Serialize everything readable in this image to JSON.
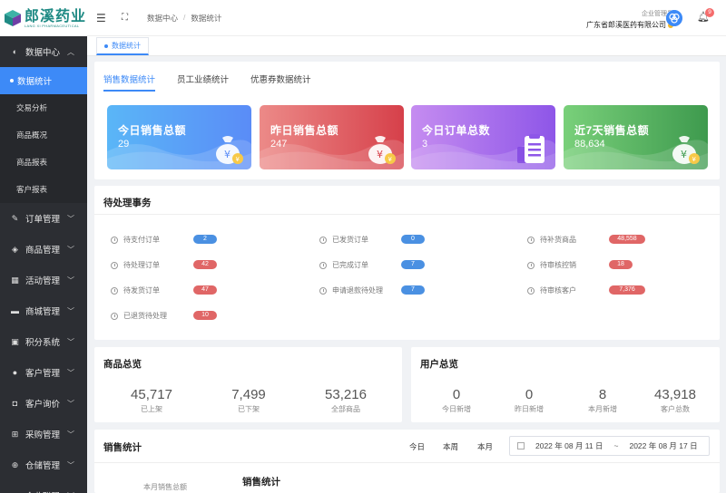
{
  "logo": {
    "cn": "郎溪药业",
    "en": "LANG XI PHARMACEUTICAL"
  },
  "sidebar": {
    "group_data_center": "数据中心",
    "active_item": "数据统计",
    "subitems": [
      "交易分析",
      "商品概况",
      "商品报表",
      "客户报表"
    ],
    "groups": [
      {
        "label": "订单管理",
        "icon": "order-icon",
        "glyph": "✎"
      },
      {
        "label": "商品管理",
        "icon": "layers-icon",
        "glyph": "◈"
      },
      {
        "label": "活动管理",
        "icon": "calendar-icon",
        "glyph": "▦"
      },
      {
        "label": "商城管理",
        "icon": "shop-icon",
        "glyph": "▬"
      },
      {
        "label": "积分系统",
        "icon": "gift-icon",
        "glyph": "▣"
      },
      {
        "label": "客户管理",
        "icon": "user-icon",
        "glyph": "●"
      },
      {
        "label": "客户询价",
        "icon": "chat-icon",
        "glyph": "◘"
      },
      {
        "label": "采购管理",
        "icon": "cart-icon",
        "glyph": "⊞"
      },
      {
        "label": "仓储管理",
        "icon": "warehouse-icon",
        "glyph": "⊕"
      },
      {
        "label": "企业联盟",
        "icon": "alliance-icon",
        "glyph": "⊗"
      }
    ]
  },
  "header": {
    "breadcrumb": [
      "数据中心",
      "数据统计"
    ],
    "breadcrumb_sep": "/",
    "role": "企业管理员",
    "company": "广东省郎溪医药有限公司",
    "notice_count": "9"
  },
  "tagsbar": {
    "active_tag": "数据统计"
  },
  "tabs": [
    "销售数据统计",
    "员工业绩统计",
    "优惠券数据统计"
  ],
  "cards": [
    {
      "title": "今日销售总额",
      "value": "29",
      "color": "#5ab6f7",
      "color2": "#5a8cf7",
      "icon": "money-bag-icon"
    },
    {
      "title": "昨日销售总额",
      "value": "247",
      "color": "#ec8a88",
      "color2": "#d6404a",
      "icon": "money-bag-icon"
    },
    {
      "title": "今日订单总数",
      "value": "3",
      "color": "#c58cf0",
      "color2": "#8e56e8",
      "icon": "clipboard-icon"
    },
    {
      "title": "近7天销售总额",
      "value": "88,634",
      "color": "#79d07a",
      "color2": "#3e9a4e",
      "icon": "money-bag-icon"
    }
  ],
  "todo": {
    "title": "待处理事务",
    "items": [
      {
        "label": "待支付订单",
        "count": "2",
        "tone": "blue"
      },
      {
        "label": "已发货订单",
        "count": "0",
        "tone": "blue"
      },
      {
        "label": "待补货商品",
        "count": "48,558",
        "tone": "red"
      },
      {
        "label": "待处理订单",
        "count": "42",
        "tone": "red"
      },
      {
        "label": "已完成订单",
        "count": "7",
        "tone": "blue"
      },
      {
        "label": "待审核控销",
        "count": "18",
        "tone": "red"
      },
      {
        "label": "待发货订单",
        "count": "47",
        "tone": "red"
      },
      {
        "label": "申请退款待处理",
        "count": "7",
        "tone": "blue"
      },
      {
        "label": "待审核客户",
        "count": "7,376",
        "tone": "red"
      },
      {
        "label": "已退货待处理",
        "count": "10",
        "tone": "red"
      }
    ]
  },
  "goods": {
    "title": "商品总览",
    "stats": [
      {
        "value": "45,717",
        "label": "已上架"
      },
      {
        "value": "7,499",
        "label": "已下架"
      },
      {
        "value": "53,216",
        "label": "全部商品"
      }
    ]
  },
  "users": {
    "title": "用户总览",
    "stats": [
      {
        "value": "0",
        "label": "今日新增"
      },
      {
        "value": "0",
        "label": "昨日新增"
      },
      {
        "value": "8",
        "label": "本月新增"
      },
      {
        "value": "43,918",
        "label": "客户总数"
      }
    ]
  },
  "sales": {
    "title": "销售统计",
    "ranges": [
      "今日",
      "本周",
      "本月"
    ],
    "date_start": "2022 年 08 月 11 日",
    "date_sep": "~",
    "date_end": "2022 年 08 月 17 日",
    "month_label": "本月销售总额",
    "chart_title": "销售统计"
  }
}
